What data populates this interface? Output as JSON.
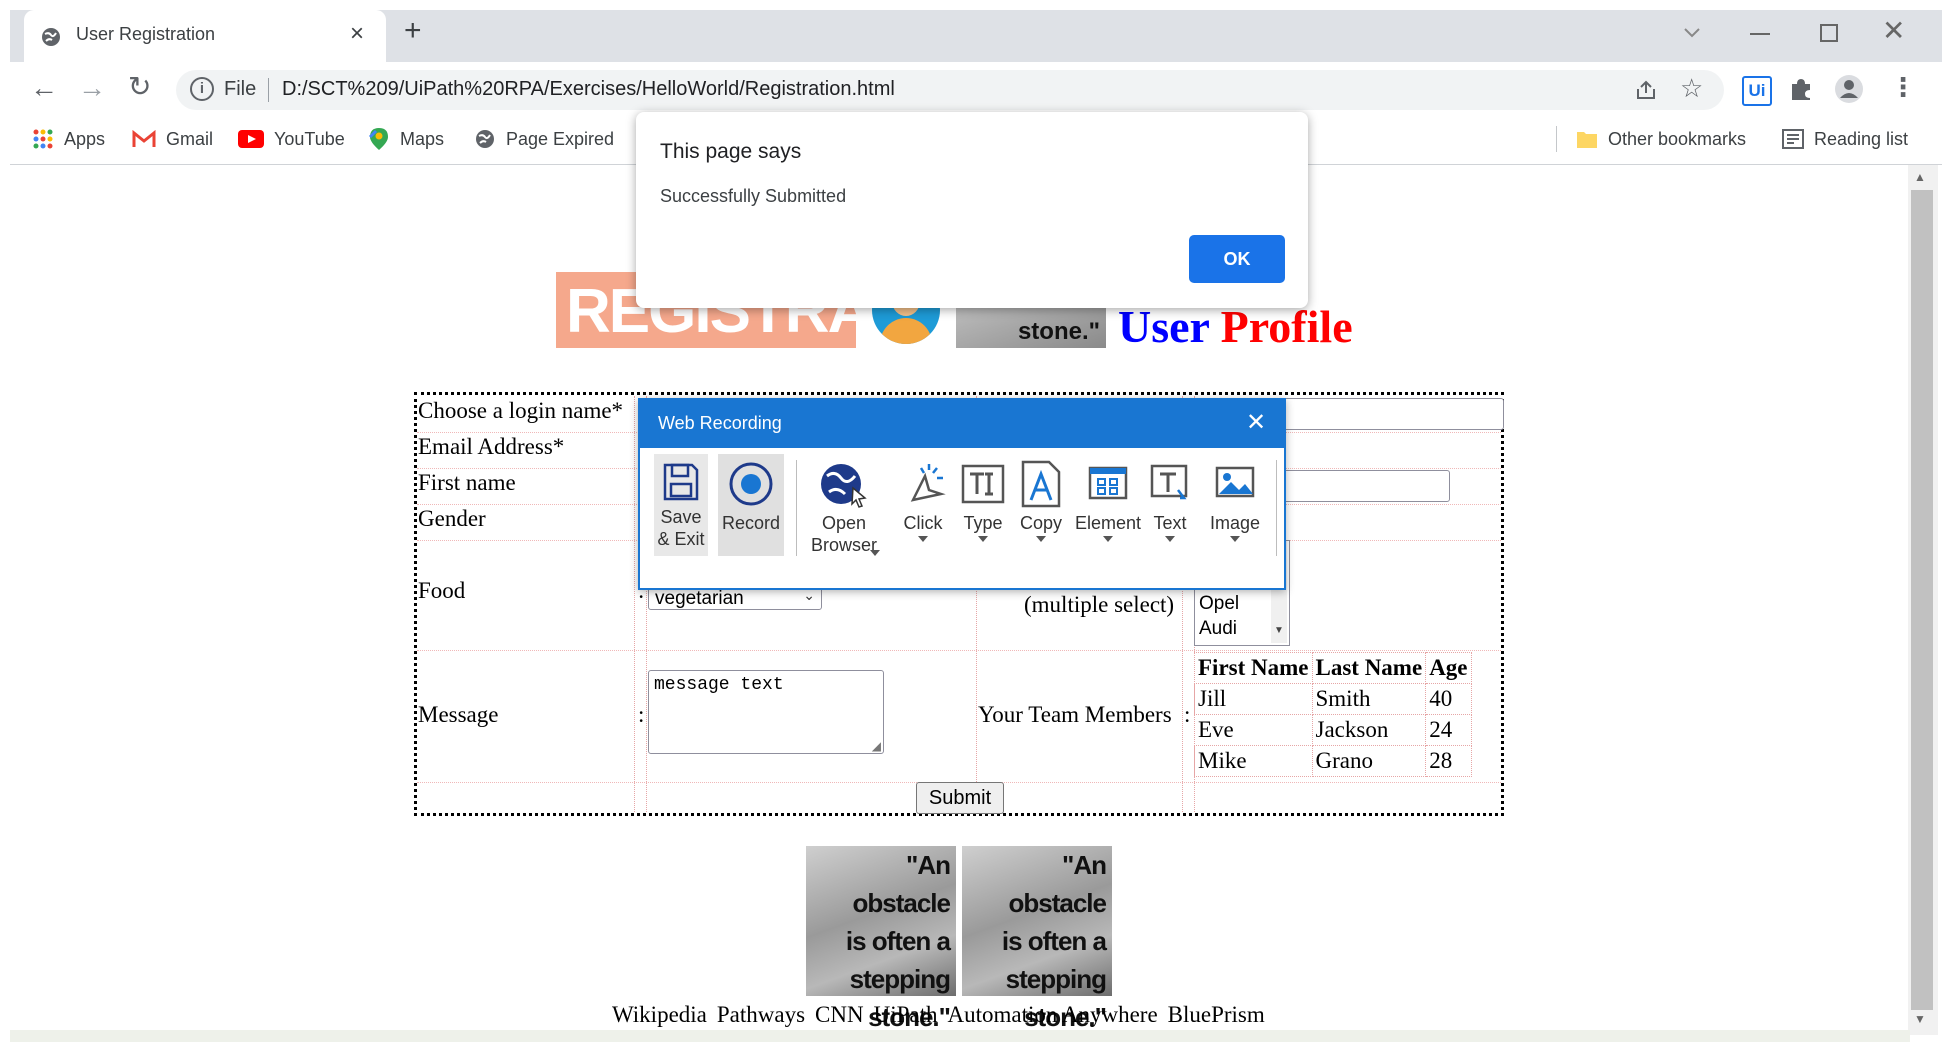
{
  "browser": {
    "tab_title": "User Registration",
    "address_prefix": "File",
    "url": "D:/SCT%209/UiPath%20RPA/Exercises/HelloWorld/Registration.html",
    "bookmarks": [
      "Apps",
      "Gmail",
      "YouTube",
      "Maps",
      "Page Expired"
    ],
    "other_bookmarks": "Other bookmarks",
    "reading_list": "Reading list",
    "uipath_ext_label": "Ui"
  },
  "alert": {
    "title": "This page says",
    "message": "Successfully Submitted",
    "ok_label": "OK"
  },
  "web_recording": {
    "title": "Web Recording",
    "tools": {
      "save_exit": "Save\n& Exit",
      "save_line1": "Save",
      "save_line2": "& Exit",
      "record": "Record",
      "open_line1": "Open",
      "open_line2": "Browser",
      "click": "Click",
      "type": "Type",
      "copy": "Copy",
      "element": "Element",
      "text": "Text",
      "image": "Image"
    }
  },
  "header": {
    "banner_text": "REGISTRATION",
    "quote_fragment": "stone.\"",
    "title_user": "User",
    "title_profile": "Profile"
  },
  "form": {
    "login_label": "Choose a login name*",
    "email_label": "Email Address*",
    "firstname_label": "First name",
    "gender_label": "Gender",
    "food_label": "Food",
    "food_separator": ":",
    "food_selected": "vegetarian",
    "multiselect_label": "(multiple select)",
    "cars_visible": [
      "Opel",
      "Audi"
    ],
    "message_label": "Message",
    "message_separator": ":",
    "message_text": "message text",
    "team_label": "Your Team Members",
    "team_separator": ":",
    "team_headers": [
      "First Name",
      "Last Name",
      "Age"
    ],
    "team_rows": [
      [
        "Jill",
        "Smith",
        "40"
      ],
      [
        "Eve",
        "Jackson",
        "24"
      ],
      [
        "Mike",
        "Grano",
        "28"
      ]
    ],
    "submit_label": "Submit"
  },
  "footer": {
    "quote_lines": [
      "\"An obstacle",
      "is often a",
      "stepping",
      "stone.\""
    ],
    "links": [
      "Wikipedia",
      "Pathways",
      "CNN",
      "UiPath",
      "Automation Anywhere",
      "BluePrism"
    ]
  },
  "colors": {
    "title_user": "#0000ff",
    "title_profile": "#ff0000",
    "accent_blue": "#1a73e8",
    "recording_blue": "#1976d2"
  }
}
